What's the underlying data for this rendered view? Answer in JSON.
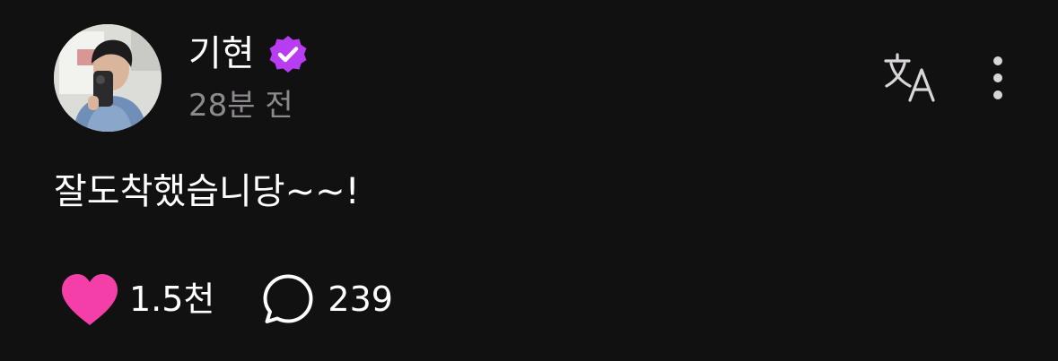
{
  "post": {
    "author": {
      "name": "기현",
      "verified": true,
      "badge_color": "#b73cf2",
      "avatar_icon": "profile-photo"
    },
    "timestamp": "28분 전",
    "text": "잘도착했습니당~~!",
    "actions": {
      "likes": {
        "icon": "heart-icon",
        "count": "1.5천",
        "color": "#f43fa8",
        "liked": true
      },
      "replies": {
        "icon": "speech-bubble-icon",
        "count": "239"
      }
    },
    "header_controls": {
      "translate_icon": "translate-icon",
      "more_icon": "more-vertical-icon"
    }
  },
  "colors": {
    "background": "#121112",
    "text_primary": "#ffffff",
    "text_secondary": "#8d8a8d",
    "icon": "#d8d6d8"
  }
}
